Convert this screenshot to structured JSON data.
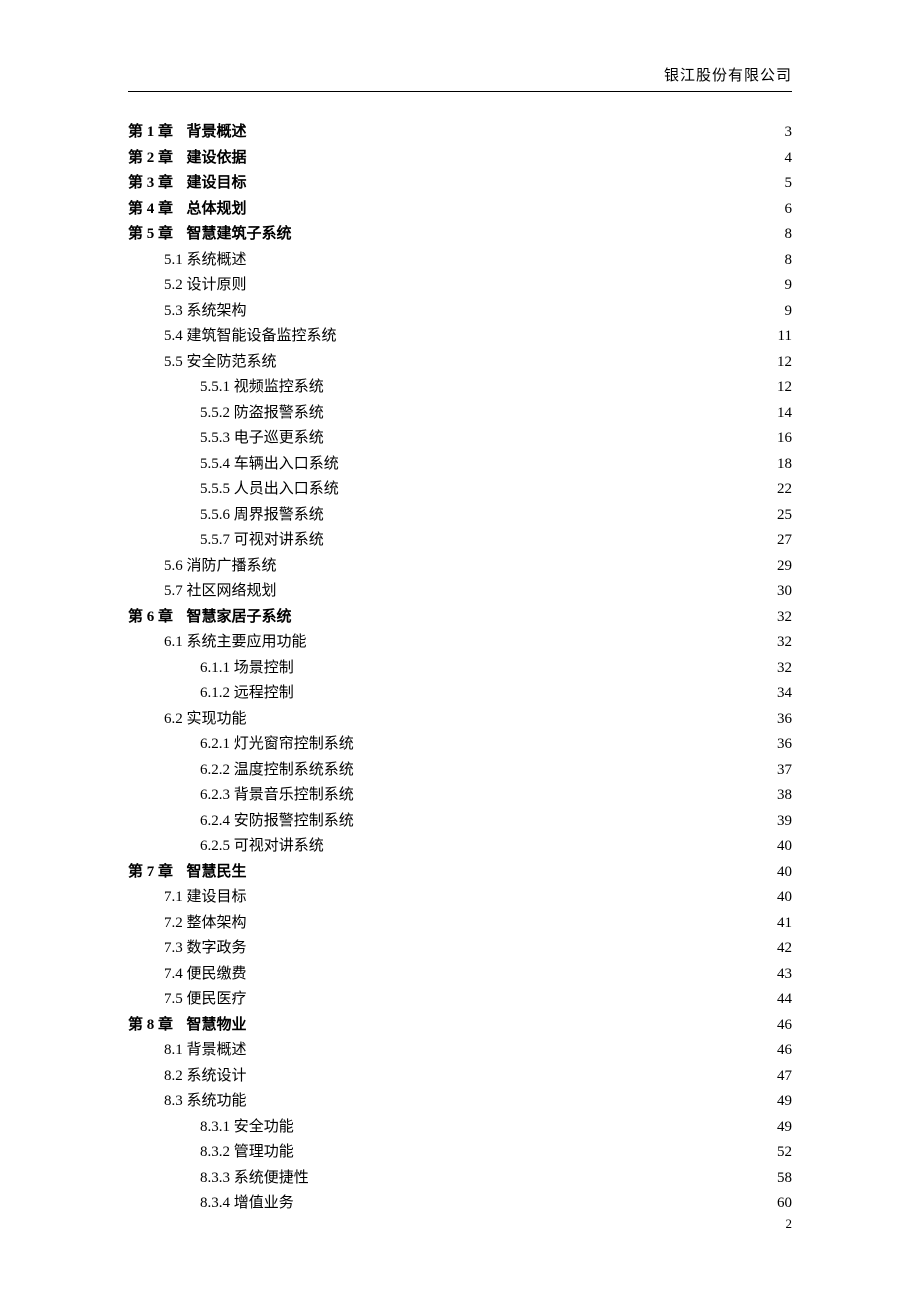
{
  "header": {
    "company": "银江股份有限公司"
  },
  "footer": {
    "page": "2"
  },
  "chapter_word": {
    "prefix": "第 ",
    "suffix": " 章"
  },
  "toc": [
    {
      "level": 0,
      "prefix": "第 ",
      "num": "1",
      "suffix": " 章",
      "title": "背景概述",
      "page": "3"
    },
    {
      "level": 0,
      "prefix": "第 ",
      "num": "2",
      "suffix": " 章",
      "title": "建设依据",
      "page": "4"
    },
    {
      "level": 0,
      "prefix": "第 ",
      "num": "3",
      "suffix": " 章",
      "title": "建设目标",
      "page": "5"
    },
    {
      "level": 0,
      "prefix": "第 ",
      "num": "4",
      "suffix": " 章",
      "title": "总体规划",
      "page": "6"
    },
    {
      "level": 0,
      "prefix": "第 ",
      "num": "5",
      "suffix": " 章",
      "title": "智慧建筑子系统",
      "page": "8"
    },
    {
      "level": 1,
      "num": "5.1",
      "title": "系统概述",
      "page": "8"
    },
    {
      "level": 1,
      "num": "5.2",
      "title": "设计原则",
      "page": "9"
    },
    {
      "level": 1,
      "num": "5.3",
      "title": "系统架构",
      "page": "9"
    },
    {
      "level": 1,
      "num": "5.4",
      "title": "建筑智能设备监控系统",
      "page": "11"
    },
    {
      "level": 1,
      "num": "5.5",
      "title": "安全防范系统",
      "page": "12"
    },
    {
      "level": 2,
      "num": "5.5.1",
      "title": "视频监控系统",
      "page": "12"
    },
    {
      "level": 2,
      "num": "5.5.2",
      "title": "防盗报警系统",
      "page": "14"
    },
    {
      "level": 2,
      "num": "5.5.3",
      "title": "电子巡更系统",
      "page": "16"
    },
    {
      "level": 2,
      "num": "5.5.4",
      "title": "车辆出入口系统",
      "page": "18"
    },
    {
      "level": 2,
      "num": "5.5.5",
      "title": "人员出入口系统",
      "page": "22"
    },
    {
      "level": 2,
      "num": "5.5.6",
      "title": "周界报警系统",
      "page": "25"
    },
    {
      "level": 2,
      "num": "5.5.7",
      "title": "可视对讲系统",
      "page": "27"
    },
    {
      "level": 1,
      "num": "5.6",
      "title": "消防广播系统",
      "page": "29"
    },
    {
      "level": 1,
      "num": "5.7",
      "title": "社区网络规划",
      "page": "30"
    },
    {
      "level": 0,
      "prefix": "第 ",
      "num": "6",
      "suffix": " 章",
      "title": "智慧家居子系统",
      "page": "32"
    },
    {
      "level": 1,
      "num": "6.1",
      "title": "系统主要应用功能",
      "page": "32"
    },
    {
      "level": 2,
      "num": "6.1.1",
      "title": "场景控制",
      "page": "32"
    },
    {
      "level": 2,
      "num": "6.1.2",
      "title": "远程控制",
      "page": "34"
    },
    {
      "level": 1,
      "num": "6.2",
      "title": "实现功能",
      "page": "36"
    },
    {
      "level": 2,
      "num": "6.2.1",
      "title": "灯光窗帘控制系统",
      "page": "36"
    },
    {
      "level": 2,
      "num": "6.2.2",
      "title": "温度控制系统系统",
      "page": "37"
    },
    {
      "level": 2,
      "num": "6.2.3",
      "title": "背景音乐控制系统",
      "page": "38"
    },
    {
      "level": 2,
      "num": "6.2.4",
      "title": "安防报警控制系统",
      "page": "39"
    },
    {
      "level": 2,
      "num": "6.2.5",
      "title": "可视对讲系统",
      "page": "40"
    },
    {
      "level": 0,
      "prefix": "第 ",
      "num": "7",
      "suffix": " 章",
      "title": "智慧民生",
      "page": "40"
    },
    {
      "level": 1,
      "num": "7.1",
      "title": "建设目标",
      "page": "40"
    },
    {
      "level": 1,
      "num": "7.2",
      "title": "整体架构",
      "page": "41"
    },
    {
      "level": 1,
      "num": "7.3",
      "title": "数字政务",
      "page": "42"
    },
    {
      "level": 1,
      "num": "7.4",
      "title": "便民缴费",
      "page": "43"
    },
    {
      "level": 1,
      "num": "7.5",
      "title": "便民医疗",
      "page": "44"
    },
    {
      "level": 0,
      "prefix": "第 ",
      "num": "8",
      "suffix": " 章",
      "title": "智慧物业",
      "page": "46"
    },
    {
      "level": 1,
      "num": "8.1",
      "title": "背景概述",
      "page": "46"
    },
    {
      "level": 1,
      "num": "8.2",
      "title": "系统设计",
      "page": "47"
    },
    {
      "level": 1,
      "num": "8.3",
      "title": "系统功能",
      "page": "49"
    },
    {
      "level": 2,
      "num": "8.3.1",
      "title": "安全功能",
      "page": "49"
    },
    {
      "level": 2,
      "num": "8.3.2",
      "title": "管理功能",
      "page": "52"
    },
    {
      "level": 2,
      "num": "8.3.3",
      "title": "系统便捷性",
      "page": "58"
    },
    {
      "level": 2,
      "num": "8.3.4",
      "title": "增值业务",
      "page": "60"
    }
  ]
}
